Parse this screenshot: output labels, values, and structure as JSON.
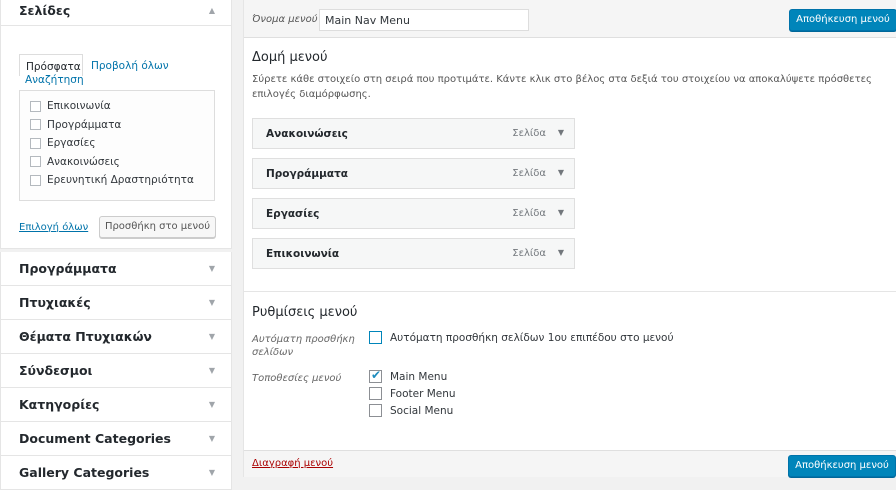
{
  "left": {
    "pages": {
      "title": "Σελίδες",
      "tabs": {
        "recent": "Πρόσφατα",
        "view_all": "Προβολή όλων",
        "search": "Αναζήτηση"
      },
      "items": [
        "Επικοινωνία",
        "Προγράμματα",
        "Εργασίες",
        "Ανακοινώσεις",
        "Ερευνητική Δραστηριότητα"
      ],
      "select_all": "Επιλογή όλων",
      "add_button": "Προσθήκη στο μενού"
    },
    "sections": [
      "Προγράμματα",
      "Πτυχιακές",
      "Θέματα Πτυχιακών",
      "Σύνδεσμοι",
      "Κατηγορίες",
      "Document Categories",
      "Gallery Categories"
    ],
    "arrow_up": "▲",
    "arrow_down": "▼"
  },
  "header": {
    "menu_name_label": "Όνομα μενού",
    "menu_name_value": "Main Nav Menu",
    "save_label": "Αποθήκευση μενού"
  },
  "structure": {
    "title": "Δομή μενού",
    "description": "Σύρετε κάθε στοιχείο στη σειρά που προτιμάτε. Κάντε κλικ στο βέλος στα δεξιά του στοιχείου να αποκαλύψετε πρόσθετες επιλογές διαμόρφωσης.",
    "items": [
      {
        "title": "Ανακοινώσεις",
        "type": "Σελίδα"
      },
      {
        "title": "Προγράμματα",
        "type": "Σελίδα"
      },
      {
        "title": "Εργασίες",
        "type": "Σελίδα"
      },
      {
        "title": "Επικοινωνία",
        "type": "Σελίδα"
      }
    ]
  },
  "settings": {
    "title": "Ρυθμίσεις μενού",
    "auto_add_label": "Αυτόματη προσθήκη σελίδων",
    "auto_add_option": "Αυτόματη προσθήκη σελίδων 1ου επιπέδου στο μενού",
    "auto_add_checked": false,
    "locations_label": "Τοποθεσίες μενού",
    "locations": [
      {
        "label": "Main Menu",
        "checked": true
      },
      {
        "label": "Footer Menu",
        "checked": false
      },
      {
        "label": "Social Menu",
        "checked": false
      }
    ]
  },
  "footer": {
    "delete_label": "Διαγραφή μενού",
    "save_label": "Αποθήκευση μενού"
  },
  "colors": {
    "primary": "#0085ba",
    "link": "#0073aa",
    "delete": "#aa0000"
  }
}
